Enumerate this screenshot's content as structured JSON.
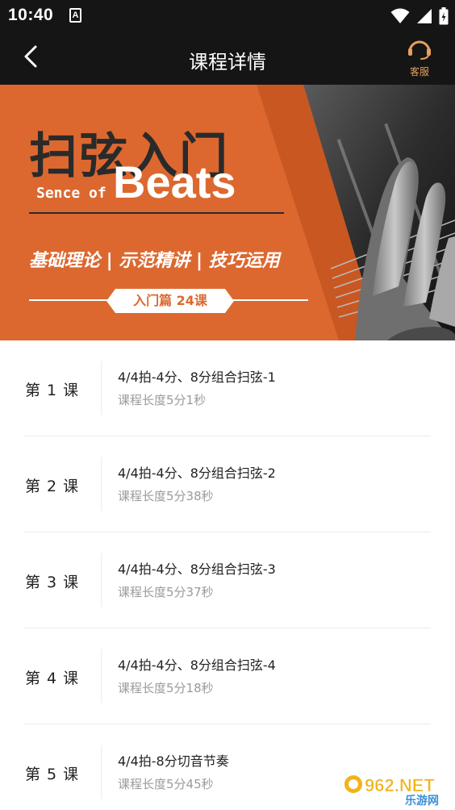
{
  "status_bar": {
    "time": "10:40",
    "notification_icon": "a-notification-icon",
    "wifi_icon": "wifi-icon",
    "signal_icon": "signal-icon",
    "battery_icon": "battery-icon"
  },
  "nav": {
    "title": "课程详情",
    "back_icon": "back-arrow-icon",
    "service_icon": "headset-icon",
    "service_label": "客服"
  },
  "banner": {
    "title_cn": "扫弦入门",
    "title_en_small": "Sence of",
    "title_en_large": "Beats",
    "features": "基础理论 | 示范精讲 | 技巧运用",
    "tag": "入门篇 24课",
    "colors": {
      "background": "#dc6830",
      "dark": "#2a2a2a"
    }
  },
  "lessons": [
    {
      "number": "第 1 课",
      "title": "4/4拍-4分、8分组合扫弦-1",
      "duration": "课程长度5分1秒"
    },
    {
      "number": "第 2 课",
      "title": "4/4拍-4分、8分组合扫弦-2",
      "duration": "课程长度5分38秒"
    },
    {
      "number": "第 3 课",
      "title": "4/4拍-4分、8分组合扫弦-3",
      "duration": "课程长度5分37秒"
    },
    {
      "number": "第 4 课",
      "title": "4/4拍-4分、8分组合扫弦-4",
      "duration": "课程长度5分18秒"
    },
    {
      "number": "第 5 课",
      "title": "4/4拍-8分切音节奏",
      "duration": "课程长度5分45秒"
    }
  ],
  "watermark": {
    "logo": "962.NET",
    "sub": "乐游网"
  }
}
